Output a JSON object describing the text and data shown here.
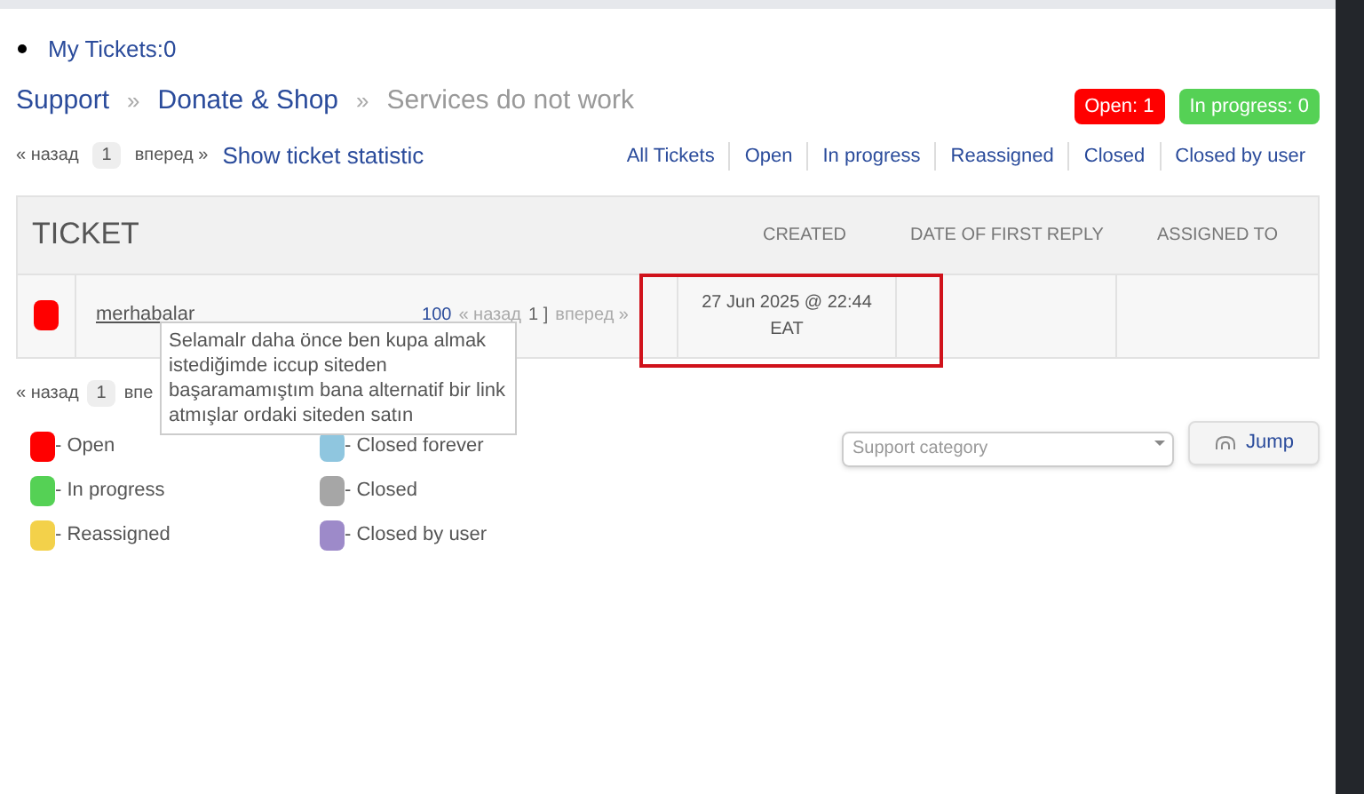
{
  "my_tickets": "My Tickets:0",
  "breadcrumb": [
    {
      "label": "Support",
      "kind": "link"
    },
    {
      "label": "Donate & Shop",
      "kind": "link"
    },
    {
      "label": "Services do not work",
      "kind": "current"
    }
  ],
  "breadcrumb_separator": "»",
  "badges": [
    {
      "label": "Open: 1",
      "color": "#ff0000"
    },
    {
      "label": "In progress: 0",
      "color": "#55d155"
    }
  ],
  "pager_top": {
    "prev": "« назад",
    "page": "1",
    "next": "вперед »"
  },
  "statistic_link": "Show ticket statistic",
  "filters": [
    "All Tickets",
    "Open",
    "In progress",
    "Reassigned",
    "Closed",
    "Closed by user"
  ],
  "table": {
    "columns": [
      "TICKET",
      "CREATED",
      "DATE OF FIRST REPLY",
      "ASSIGNED TO"
    ],
    "rows": [
      {
        "color": "#ff0000",
        "title": "merhabalar",
        "count": "100",
        "prev": "« назад",
        "page": "1 ]",
        "next": "вперед »",
        "created": "27 Jun 2025 @ 22:44 EAT"
      }
    ]
  },
  "tooltip": "Selamalr daha önce ben kupa almak istediğimde iccup siteden başaramamıştım bana alternatif bir link atmışlar ordaki siteden satın",
  "pager_bottom": {
    "prev": "« назад",
    "page": "1",
    "next": "впе"
  },
  "legend": [
    {
      "label": "- Open",
      "color": "#ff0000"
    },
    {
      "label": "- Closed forever",
      "color": "#8fc6df"
    },
    {
      "label": "- In progress",
      "color": "#55d155"
    },
    {
      "label": "- Closed",
      "color": "#a6a6a6"
    },
    {
      "label": "- Reassigned",
      "color": "#f3d14a"
    },
    {
      "label": "- Closed by user",
      "color": "#9d8ac9"
    }
  ],
  "category_select": {
    "placeholder": "Support category"
  },
  "jump_button": "Jump"
}
